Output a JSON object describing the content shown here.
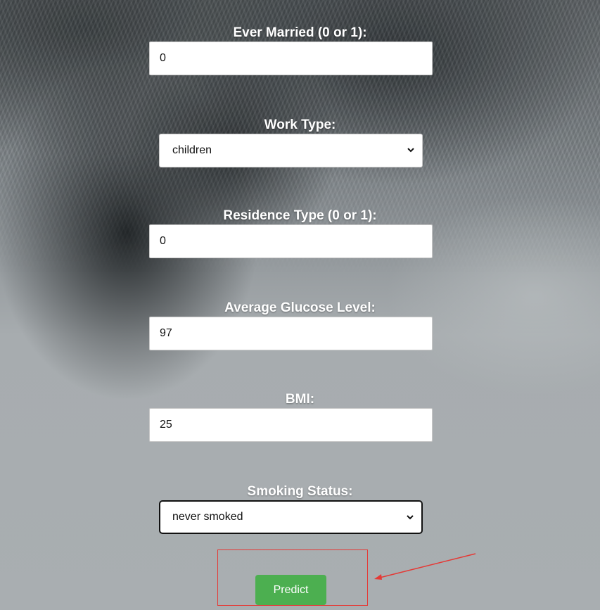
{
  "form": {
    "ever_married": {
      "label": "Ever Married (0 or 1):",
      "value": "0"
    },
    "work_type": {
      "label": "Work Type:",
      "selected": "children"
    },
    "residence_type": {
      "label": "Residence Type (0 or 1):",
      "value": "0"
    },
    "avg_glucose": {
      "label": "Average Glucose Level:",
      "value": "97"
    },
    "bmi": {
      "label": "BMI:",
      "value": "25"
    },
    "smoking_status": {
      "label": "Smoking Status:",
      "selected": "never smoked"
    },
    "predict_label": "Predict"
  },
  "colors": {
    "button": "#4caf50",
    "annotation": "#e53935"
  },
  "icons": {
    "select_indicator": "chevron-down-icon"
  }
}
